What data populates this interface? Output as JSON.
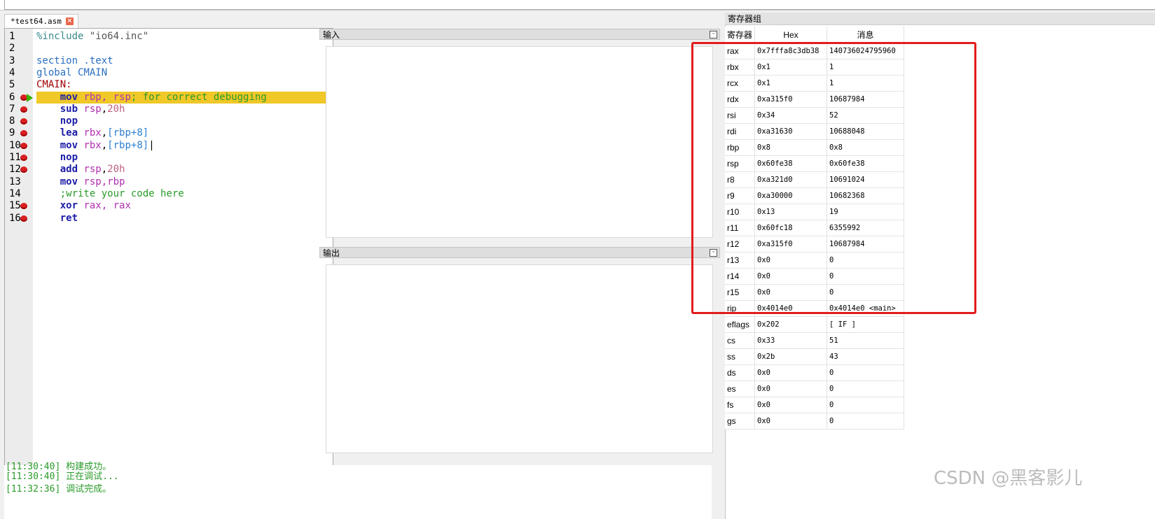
{
  "editor": {
    "tab_label": "*test64.asm",
    "tab_close_glyph": "×",
    "lines": [
      {
        "n": "1",
        "bp": false,
        "tokens": [
          {
            "c": "t-dir",
            "t": "%include "
          },
          {
            "c": "t-str",
            "t": "\"io64.inc\""
          }
        ]
      },
      {
        "n": "2",
        "bp": false,
        "tokens": []
      },
      {
        "n": "3",
        "bp": false,
        "tokens": [
          {
            "c": "t-kw",
            "t": "section .text"
          }
        ]
      },
      {
        "n": "4",
        "bp": false,
        "tokens": [
          {
            "c": "t-kw",
            "t": "global CMAIN"
          }
        ]
      },
      {
        "n": "5",
        "bp": false,
        "tokens": [
          {
            "c": "t-lbl",
            "t": "CMAIN:"
          }
        ]
      },
      {
        "n": "6",
        "bp": true,
        "current": true,
        "tokens": [
          {
            "c": "",
            "t": "    "
          },
          {
            "c": "t-op",
            "t": "mov "
          },
          {
            "c": "t-reg",
            "t": "rbp, rsp"
          },
          {
            "c": "t-cm",
            "t": "; for correct debugging"
          }
        ]
      },
      {
        "n": "7",
        "bp": true,
        "tokens": [
          {
            "c": "",
            "t": "    "
          },
          {
            "c": "t-op",
            "t": "sub "
          },
          {
            "c": "t-reg",
            "t": "rsp"
          },
          {
            "c": "",
            "t": ","
          },
          {
            "c": "t-num",
            "t": "20h"
          }
        ]
      },
      {
        "n": "8",
        "bp": true,
        "tokens": [
          {
            "c": "",
            "t": "    "
          },
          {
            "c": "t-op",
            "t": "nop"
          }
        ]
      },
      {
        "n": "9",
        "bp": true,
        "tokens": [
          {
            "c": "",
            "t": "    "
          },
          {
            "c": "t-op",
            "t": "lea "
          },
          {
            "c": "t-reg",
            "t": "rbx"
          },
          {
            "c": "",
            "t": ","
          },
          {
            "c": "t-br",
            "t": "[rbp+8]"
          }
        ]
      },
      {
        "n": "10",
        "bp": true,
        "tokens": [
          {
            "c": "",
            "t": "    "
          },
          {
            "c": "t-op",
            "t": "mov "
          },
          {
            "c": "t-reg",
            "t": "rbx"
          },
          {
            "c": "",
            "t": ","
          },
          {
            "c": "t-br",
            "t": "[rbp+8]"
          },
          {
            "c": "",
            "t": "|"
          }
        ]
      },
      {
        "n": "11",
        "bp": true,
        "tokens": [
          {
            "c": "",
            "t": "    "
          },
          {
            "c": "t-op",
            "t": "nop"
          }
        ]
      },
      {
        "n": "12",
        "bp": true,
        "tokens": [
          {
            "c": "",
            "t": "    "
          },
          {
            "c": "t-op",
            "t": "add "
          },
          {
            "c": "t-reg",
            "t": "rsp"
          },
          {
            "c": "",
            "t": ","
          },
          {
            "c": "t-num",
            "t": "20h"
          }
        ]
      },
      {
        "n": "13",
        "bp": false,
        "tokens": [
          {
            "c": "",
            "t": "    "
          },
          {
            "c": "t-op",
            "t": "mov "
          },
          {
            "c": "t-reg",
            "t": "rsp,rbp"
          }
        ]
      },
      {
        "n": "14",
        "bp": false,
        "tokens": [
          {
            "c": "",
            "t": "    "
          },
          {
            "c": "t-cm",
            "t": ";write your code here"
          }
        ]
      },
      {
        "n": "15",
        "bp": true,
        "tokens": [
          {
            "c": "",
            "t": "    "
          },
          {
            "c": "t-op",
            "t": "xor "
          },
          {
            "c": "t-reg",
            "t": "rax, rax"
          }
        ]
      },
      {
        "n": "16",
        "bp": true,
        "tokens": [
          {
            "c": "",
            "t": "    "
          },
          {
            "c": "t-op",
            "t": "ret"
          }
        ]
      }
    ]
  },
  "panes": {
    "input_label": "输入",
    "output_label": "输出",
    "restore_glyph": "▫"
  },
  "log": {
    "lines": [
      "[11:30:40] 正在调试...",
      "[11:32:36] 调试完成。"
    ],
    "partial_line": "[11:30:40] 构建成功。"
  },
  "registers": {
    "title": "寄存器组",
    "headers": [
      "寄存器",
      "Hex",
      "消息"
    ],
    "rows": [
      [
        "rax",
        "0x7fffa8c3db38",
        "140736024795960"
      ],
      [
        "rbx",
        "0x1",
        "1"
      ],
      [
        "rcx",
        "0x1",
        "1"
      ],
      [
        "rdx",
        "0xa315f0",
        "10687984"
      ],
      [
        "rsi",
        "0x34",
        "52"
      ],
      [
        "rdi",
        "0xa31630",
        "10688048"
      ],
      [
        "rbp",
        "0x8",
        "0x8"
      ],
      [
        "rsp",
        "0x60fe38",
        "0x60fe38"
      ],
      [
        "r8",
        "0xa321d0",
        "10691024"
      ],
      [
        "r9",
        "0xa30000",
        "10682368"
      ],
      [
        "r10",
        "0x13",
        "19"
      ],
      [
        "r11",
        "0x60fc18",
        "6355992"
      ],
      [
        "r12",
        "0xa315f0",
        "10687984"
      ],
      [
        "r13",
        "0x0",
        "0"
      ],
      [
        "r14",
        "0x0",
        "0"
      ],
      [
        "r15",
        "0x0",
        "0"
      ],
      [
        "rip",
        "0x4014e0",
        "0x4014e0 <main>"
      ],
      [
        "eflags",
        "0x202",
        "[ IF ]"
      ],
      [
        "cs",
        "0x33",
        "51"
      ],
      [
        "ss",
        "0x2b",
        "43"
      ],
      [
        "ds",
        "0x0",
        "0"
      ],
      [
        "es",
        "0x0",
        "0"
      ],
      [
        "fs",
        "0x0",
        "0"
      ],
      [
        "gs",
        "0x0",
        "0"
      ]
    ]
  },
  "watermark": "CSDN @黑客影儿",
  "colors": {
    "highlight": "#f0c828",
    "annotation_box": "#e21c1c",
    "breakpoint": "#d92020"
  }
}
